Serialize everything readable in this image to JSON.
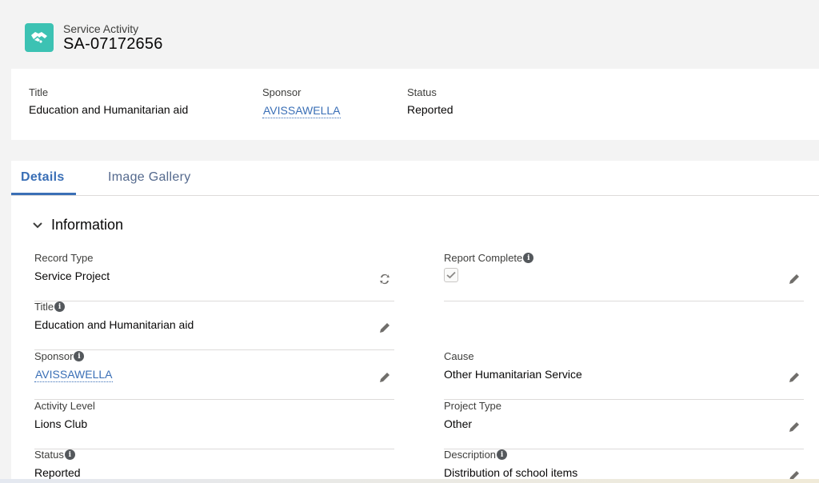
{
  "header": {
    "object_type": "Service Activity",
    "record_id": "SA-07172656",
    "icon": "handshake-icon",
    "icon_color": "#3cc2b3"
  },
  "highlights": {
    "title_label": "Title",
    "title_value": "Education and Humanitarian aid",
    "sponsor_label": "Sponsor",
    "sponsor_value": "AVISSAWELLA",
    "status_label": "Status",
    "status_value": "Reported"
  },
  "tabs": [
    {
      "label": "Details",
      "active": true
    },
    {
      "label": "Image Gallery",
      "active": false
    }
  ],
  "section": {
    "title": "Information"
  },
  "fields": {
    "record_type": {
      "label": "Record Type",
      "value": "Service Project"
    },
    "report_complete": {
      "label": "Report Complete",
      "checked": true
    },
    "title": {
      "label": "Title",
      "value": "Education and Humanitarian aid"
    },
    "sponsor": {
      "label": "Sponsor",
      "value": "AVISSAWELLA"
    },
    "cause": {
      "label": "Cause",
      "value": "Other Humanitarian Service"
    },
    "activity_level": {
      "label": "Activity Level",
      "value": "Lions Club"
    },
    "project_type": {
      "label": "Project Type",
      "value": "Other"
    },
    "status": {
      "label": "Status",
      "value": "Reported"
    },
    "description": {
      "label": "Description",
      "value": "Distribution of school items"
    }
  },
  "colors": {
    "accent": "#3a6fb6",
    "link": "#3a6fb6",
    "background": "#f3f3f3"
  }
}
